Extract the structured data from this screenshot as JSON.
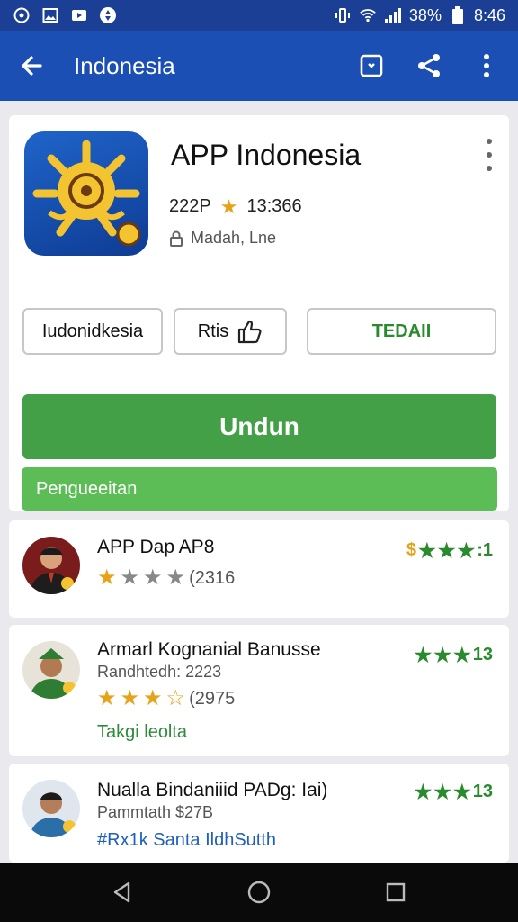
{
  "status_bar": {
    "battery": "38%",
    "time": "8:46"
  },
  "app_bar": {
    "title": "Indonesia"
  },
  "app": {
    "name": "APP Indonesia",
    "size": "222P",
    "rating": "13:366",
    "publisher": "Madah, Lne"
  },
  "chips": {
    "chip1": "Iudonidkesia",
    "chip2": "Rtis",
    "chip3": "TEDAII"
  },
  "buttons": {
    "install": "Undun",
    "secondary": "Pengueeitan"
  },
  "reviews": [
    {
      "name": "APP Dap AP8",
      "stars_filled": 1,
      "stars_total": 4,
      "count": "(2316",
      "right_prefix": "$",
      "right_value": ":1"
    },
    {
      "name": "Armarl Kognanial Banusse",
      "subtitle": "Randhtedh: 2223",
      "stars_filled": 3,
      "stars_total": 4,
      "count": "(2975",
      "tag": "Takgi leolta",
      "right_value": "13"
    },
    {
      "name": "Nualla Bindaniiid PADg: Iai)",
      "subtitle": "Pammtath $27B",
      "tag": "#Rx1k Santa IldhSutth",
      "right_value": "13"
    }
  ],
  "colors": {
    "primary": "#1c4fb3",
    "status_bar": "#1a3f95",
    "install": "#43a047",
    "secondary": "#5cbd56",
    "accent_green": "#2a8b2e",
    "star_gold": "#e8a21a"
  }
}
